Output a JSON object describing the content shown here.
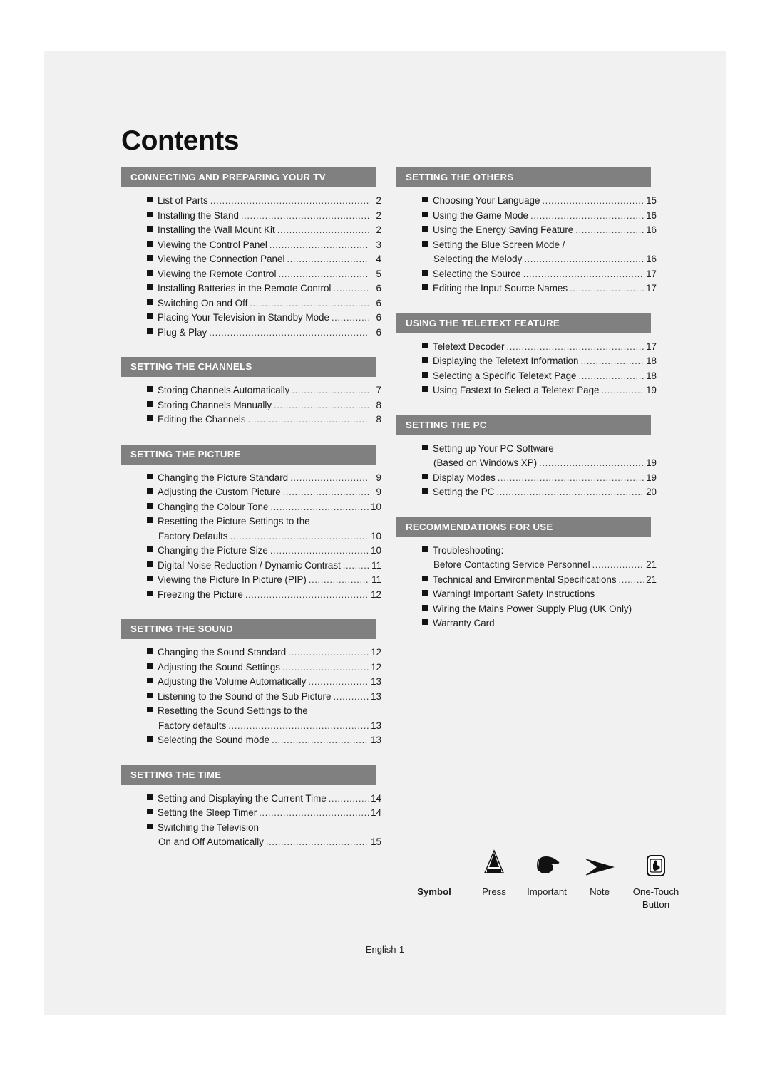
{
  "page": {
    "title": "Contents",
    "footer": "English-1"
  },
  "columns": {
    "left": [
      {
        "heading": "CONNECTING AND PREPARING YOUR TV",
        "entries": [
          {
            "text": "List of Parts",
            "page": "2",
            "bullet": true,
            "dots": true
          },
          {
            "text": "Installing the Stand",
            "page": "2",
            "bullet": true,
            "dots": true
          },
          {
            "text": "Installing the Wall Mount Kit",
            "page": "2",
            "bullet": true,
            "dots": true
          },
          {
            "text": "Viewing the Control Panel",
            "page": "3",
            "bullet": true,
            "dots": true
          },
          {
            "text": "Viewing the Connection Panel",
            "page": "4",
            "bullet": true,
            "dots": true
          },
          {
            "text": "Viewing the Remote Control",
            "page": "5",
            "bullet": true,
            "dots": true
          },
          {
            "text": "Installing Batteries in the Remote Control",
            "page": "6",
            "bullet": true,
            "dots": true
          },
          {
            "text": "Switching On and Off",
            "page": "6",
            "bullet": true,
            "dots": true
          },
          {
            "text": "Placing Your Television in Standby Mode",
            "page": "6",
            "bullet": true,
            "dots": true
          },
          {
            "text": "Plug & Play",
            "page": "6",
            "bullet": true,
            "dots": true
          }
        ]
      },
      {
        "heading": "SETTING THE CHANNELS",
        "entries": [
          {
            "text": "Storing Channels Automatically",
            "page": "7",
            "bullet": true,
            "dots": true
          },
          {
            "text": "Storing Channels Manually",
            "page": "8",
            "bullet": true,
            "dots": true
          },
          {
            "text": "Editing the Channels",
            "page": "8",
            "bullet": true,
            "dots": true
          }
        ]
      },
      {
        "heading": "SETTING THE PICTURE",
        "entries": [
          {
            "text": "Changing the Picture Standard",
            "page": "9",
            "bullet": true,
            "dots": true
          },
          {
            "text": "Adjusting the Custom Picture",
            "page": "9",
            "bullet": true,
            "dots": true
          },
          {
            "text": "Changing the Colour Tone",
            "page": "10",
            "bullet": true,
            "dots": true
          },
          {
            "text": "Resetting the Picture Settings to the",
            "page": "",
            "bullet": true,
            "dots": false
          },
          {
            "text": "Factory Defaults",
            "page": "10",
            "bullet": false,
            "dots": true,
            "continuation": true
          },
          {
            "text": "Changing the Picture Size",
            "page": "10",
            "bullet": true,
            "dots": true
          },
          {
            "text": "Digital Noise Reduction / Dynamic Contrast",
            "page": "11",
            "bullet": true,
            "dots": true
          },
          {
            "text": "Viewing the Picture In Picture (PIP)",
            "page": "11",
            "bullet": true,
            "dots": true
          },
          {
            "text": "Freezing the Picture",
            "page": "12",
            "bullet": true,
            "dots": true
          }
        ]
      },
      {
        "heading": "SETTING THE SOUND",
        "entries": [
          {
            "text": "Changing the Sound Standard",
            "page": "12",
            "bullet": true,
            "dots": true
          },
          {
            "text": "Adjusting the Sound Settings",
            "page": "12",
            "bullet": true,
            "dots": true
          },
          {
            "text": "Adjusting the Volume Automatically",
            "page": "13",
            "bullet": true,
            "dots": true
          },
          {
            "text": "Listening to the Sound of the Sub Picture",
            "page": "13",
            "bullet": true,
            "dots": true
          },
          {
            "text": "Resetting the Sound Settings to the",
            "page": "",
            "bullet": true,
            "dots": false
          },
          {
            "text": "Factory defaults",
            "page": "13",
            "bullet": false,
            "dots": true,
            "continuation": true
          },
          {
            "text": "Selecting the Sound mode",
            "page": "13",
            "bullet": true,
            "dots": true
          }
        ]
      },
      {
        "heading": "SETTING THE TIME",
        "entries": [
          {
            "text": "Setting and Displaying the Current Time",
            "page": "14",
            "bullet": true,
            "dots": true
          },
          {
            "text": "Setting the Sleep Timer",
            "page": "14",
            "bullet": true,
            "dots": true
          },
          {
            "text": "Switching the Television",
            "page": "",
            "bullet": true,
            "dots": false
          },
          {
            "text": "On and Off Automatically",
            "page": "15",
            "bullet": false,
            "dots": true,
            "continuation": true
          }
        ]
      }
    ],
    "right": [
      {
        "heading": "SETTING THE OTHERS",
        "entries": [
          {
            "text": "Choosing Your Language",
            "page": "15",
            "bullet": true,
            "dots": true
          },
          {
            "text": "Using the Game Mode",
            "page": "16",
            "bullet": true,
            "dots": true
          },
          {
            "text": "Using the Energy Saving Feature",
            "page": "16",
            "bullet": true,
            "dots": true
          },
          {
            "text": "Setting the Blue Screen Mode /",
            "page": "",
            "bullet": true,
            "dots": false
          },
          {
            "text": "Selecting the Melody",
            "page": "16",
            "bullet": false,
            "dots": true,
            "continuation": true
          },
          {
            "text": "Selecting the Source",
            "page": "17",
            "bullet": true,
            "dots": true
          },
          {
            "text": "Editing the Input Source Names",
            "page": "17",
            "bullet": true,
            "dots": true
          }
        ]
      },
      {
        "heading": "USING THE TELETEXT FEATURE",
        "entries": [
          {
            "text": "Teletext Decoder",
            "page": "17",
            "bullet": true,
            "dots": true
          },
          {
            "text": "Displaying the Teletext Information",
            "page": "18",
            "bullet": true,
            "dots": true
          },
          {
            "text": "Selecting a Specific Teletext Page",
            "page": "18",
            "bullet": true,
            "dots": true
          },
          {
            "text": "Using Fastext to Select a Teletext Page",
            "page": "19",
            "bullet": true,
            "dots": true
          }
        ]
      },
      {
        "heading": "SETTING THE PC",
        "entries": [
          {
            "text": "Setting up Your PC Software",
            "page": "",
            "bullet": true,
            "dots": false
          },
          {
            "text": "(Based on Windows XP)",
            "page": "19",
            "bullet": false,
            "dots": true,
            "continuation": true
          },
          {
            "text": "Display Modes",
            "page": "19",
            "bullet": true,
            "dots": true
          },
          {
            "text": "Setting the PC",
            "page": "20",
            "bullet": true,
            "dots": true
          }
        ]
      },
      {
        "heading": "RECOMMENDATIONS FOR USE",
        "entries": [
          {
            "text": "Troubleshooting:",
            "page": "",
            "bullet": true,
            "dots": false
          },
          {
            "text": "Before Contacting Service Personnel",
            "page": "21",
            "bullet": false,
            "dots": true,
            "continuation": true
          },
          {
            "text": "Technical and Environmental Specifications",
            "page": "21",
            "bullet": true,
            "dots": true
          },
          {
            "text": "Warning! Important Safety Instructions",
            "page": "",
            "bullet": true,
            "dots": false
          },
          {
            "text": "Wiring the Mains Power Supply Plug (UK Only)",
            "page": "",
            "bullet": true,
            "dots": false
          },
          {
            "text": "Warranty Card",
            "page": "",
            "bullet": true,
            "dots": false
          }
        ]
      }
    ]
  },
  "legend": {
    "title": "Symbol",
    "items": [
      {
        "icon": "press-triangle-icon",
        "label": "Press"
      },
      {
        "icon": "pointing-hand-icon",
        "label": "Important"
      },
      {
        "icon": "note-arrow-icon",
        "label": "Note"
      },
      {
        "icon": "one-touch-button-icon",
        "label": "One-Touch"
      }
    ],
    "one_touch_second_line": "Button"
  },
  "colors": {
    "page_background": "#f1f1f1",
    "heading_bar": "#808080",
    "heading_text": "#ffffff",
    "body_text": "#1b1b1b"
  }
}
